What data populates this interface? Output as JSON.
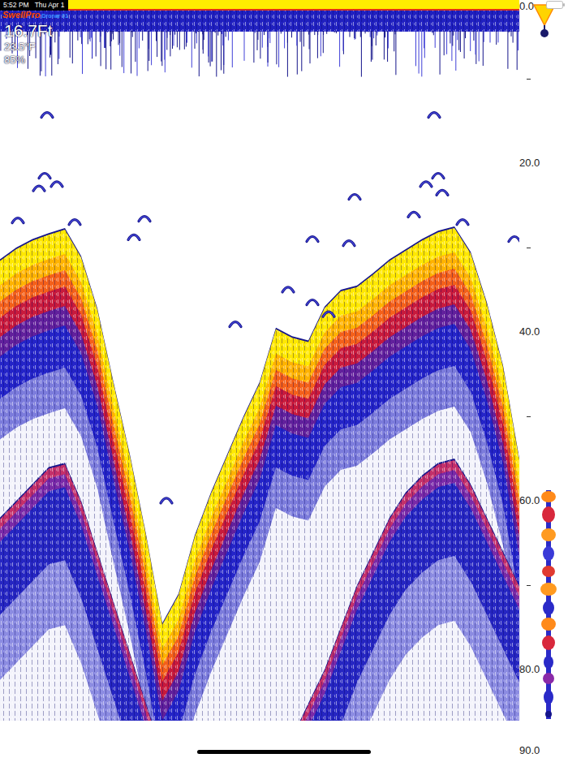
{
  "status_bar": {
    "time": "5:52 PM",
    "date": "Thu Apr 1"
  },
  "logo": {
    "brand": "SwellPro",
    "model": "Dronar 01"
  },
  "readings": {
    "depth": "16.7Ft",
    "temperature": "23.5°F",
    "signal": "85%"
  },
  "depth_scale": {
    "ticks": [
      {
        "label": "0.0",
        "depth": 0
      },
      {
        "label": "20.0",
        "depth": 20
      },
      {
        "label": "40.0",
        "depth": 40
      },
      {
        "label": "60.0",
        "depth": 60
      },
      {
        "label": "80.0",
        "depth": 80
      },
      {
        "label": "90.0",
        "depth": 90
      }
    ],
    "minor_ticks": [
      10,
      30,
      50,
      70
    ]
  },
  "echogram": {
    "unit": "ft",
    "bottom": [
      31.4,
      30,
      29,
      28.3,
      27.7,
      31,
      37.2,
      46,
      54.5,
      64,
      74.5,
      71,
      64.1,
      59,
      54.5,
      50,
      45.9,
      39.5,
      40.5,
      41,
      37,
      35,
      34.5,
      33,
      31.4,
      30.2,
      29,
      28,
      27.5,
      30.5,
      36.5,
      44,
      55
    ],
    "second_echo": [
      62,
      60,
      58,
      56,
      55.5,
      60,
      66,
      72,
      78,
      84,
      90,
      90,
      90,
      90,
      90,
      90,
      90,
      90,
      88,
      84,
      80,
      75,
      70,
      66,
      62,
      59,
      57,
      55.5,
      55,
      58,
      62,
      66,
      70
    ],
    "fish": [
      {
        "ping": 58,
        "depth": 14.1
      },
      {
        "ping": 535,
        "depth": 14.1
      },
      {
        "ping": 55,
        "depth": 21.3
      },
      {
        "ping": 70,
        "depth": 22.3
      },
      {
        "ping": 48,
        "depth": 22.8
      },
      {
        "ping": 22,
        "depth": 26.6
      },
      {
        "ping": 92,
        "depth": 26.8
      },
      {
        "ping": 178,
        "depth": 26.4
      },
      {
        "ping": 165,
        "depth": 28.6
      },
      {
        "ping": 540,
        "depth": 21.3
      },
      {
        "ping": 525,
        "depth": 22.3
      },
      {
        "ping": 545,
        "depth": 23.3
      },
      {
        "ping": 570,
        "depth": 26.8
      },
      {
        "ping": 510,
        "depth": 25.9
      },
      {
        "ping": 437,
        "depth": 23.8
      },
      {
        "ping": 385,
        "depth": 28.8
      },
      {
        "ping": 430,
        "depth": 29.3
      },
      {
        "ping": 355,
        "depth": 34.8
      },
      {
        "ping": 385,
        "depth": 36.3
      },
      {
        "ping": 405,
        "depth": 37.7
      },
      {
        "ping": 290,
        "depth": 38.9
      },
      {
        "ping": 205,
        "depth": 59.8
      },
      {
        "ping": 634,
        "depth": 28.8
      }
    ]
  }
}
